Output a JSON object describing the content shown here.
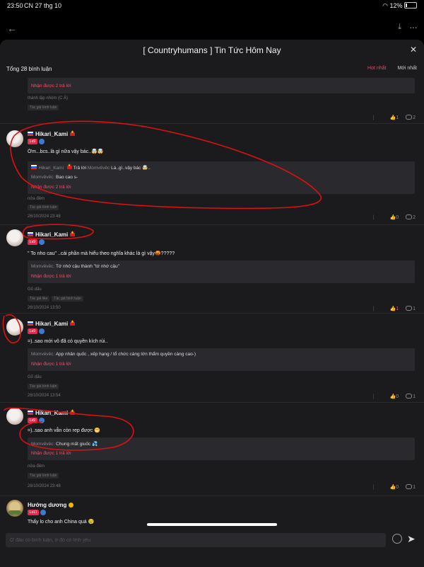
{
  "status": {
    "time": "23:50",
    "date": "CN 27 thg 10",
    "battery": "12%"
  },
  "sheet": {
    "title": "[ Countryhumans ] Tin Tức Hôm Nay",
    "total": "Tổng 28 bình luận",
    "sort_hot": "Hot nhất",
    "sort_new": "Mới nhất"
  },
  "comment0": {
    "replies": "Nhận được 2 trả lời",
    "text2": "thành lập nhóm (C Á)",
    "tag": "Tác giả bình luận",
    "likes": "1",
    "comments": "2"
  },
  "comment1": {
    "name": "Hikari_Kami",
    "level": "Lv9",
    "text": "Ờm...bcs..là gì nữa vậy bác..🤯🤯",
    "r1_name": "Hikari_Kami",
    "r1_mid": "Trả lời",
    "r1_target": "Momvêvêc",
    "r1_text": "Là..gì..vậy bác 🤯..",
    "r2_name": "Momvêvêc:",
    "r2_text": "Bao cao s-",
    "replies": "Nhận được 2 trả lời",
    "extra": "nửa đêm",
    "tag": "Tác giả bình luận",
    "date": "26/10/2024 23:48",
    "likes": "0",
    "comments": "2"
  },
  "comment2": {
    "name": "Hikari_Kami",
    "level": "Lv9",
    "text": "\" To nho cau\" ..cái phần mà hiểu theo nghĩa khác là gì vậy🤬?????",
    "r1_name": "Momvêvêc:",
    "r1_text": "Tớ nhớ cậu thành \"tớ nhớ cậu\"",
    "replies": "Nhận được 1 trả lời",
    "extra": "Gõ dấu",
    "tag1": "Tác giả like",
    "tag2": "Tác giả bình luận",
    "date": "26/10/2024 13:50",
    "likes": "1",
    "comments": "1"
  },
  "comment3": {
    "name": "Hikari_Kami",
    "level": "Lv9",
    "text": "=)..sao mới vô đã có quyền kích rùi..",
    "r1_name": "Momvêvêc:",
    "r1_text": "App nhân quốc , xếp hạng / tổ chức càng lớn thẩm quyền càng cao-)",
    "replies": "Nhận được 1 trả lời",
    "extra": "Gõ dấu",
    "tag": "Tác giả bình luận",
    "date": "26/10/2024 13:54",
    "likes": "0",
    "comments": "1"
  },
  "comment4": {
    "name": "Hikari_Kami",
    "level": "Lv9",
    "text": "=)..sao anh vẫn còn rep được 😁",
    "r1_name": "Momvêvêc:",
    "r1_text": "Chung mất giuốc 💦",
    "replies": "Nhận được 1 trả lời",
    "extra": "nửa đêm",
    "tag": "Tác giả bình luận",
    "date": "26/10/2024 23:48",
    "likes": "0",
    "comments": "1"
  },
  "comment5": {
    "name": "Hướng dương",
    "level": "Lv11",
    "text": "Thấy lo cho anh China quá 😢"
  },
  "input": {
    "placeholder": "Ở đâu có bình luận, ở đó có tình yêu"
  }
}
